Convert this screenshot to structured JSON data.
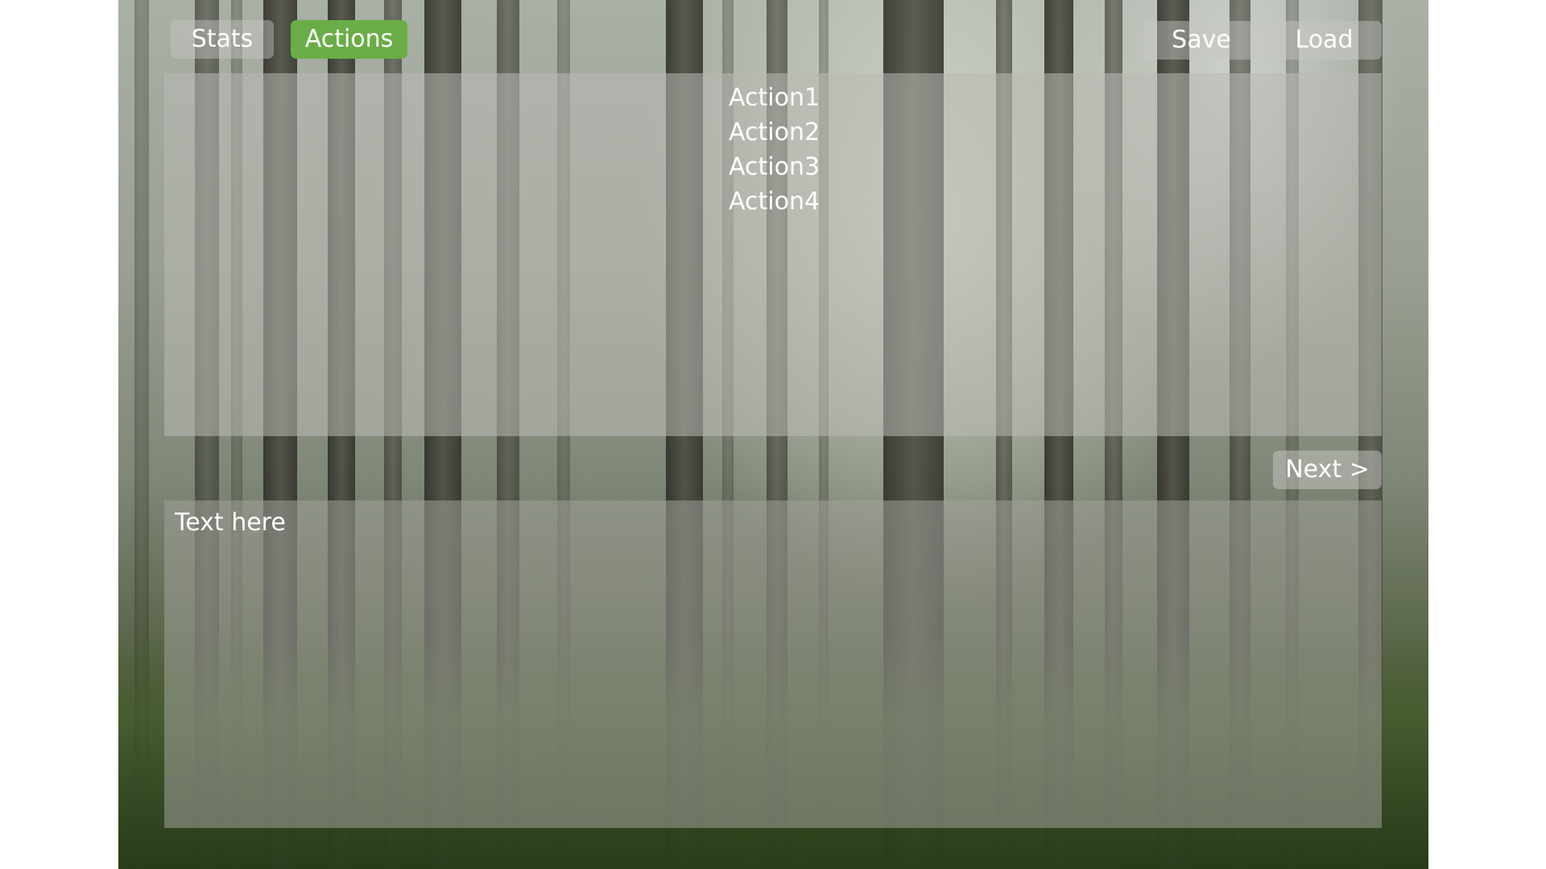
{
  "top_bar": {
    "stats_label": "Stats",
    "actions_label": "Actions",
    "save_label": "Save",
    "load_label": "Load"
  },
  "actions": {
    "items": [
      "Action1",
      "Action2",
      "Action3",
      "Action4"
    ]
  },
  "controls": {
    "next_label": "Next >"
  },
  "text_panel": {
    "content": "Text here"
  },
  "colors": {
    "active_tab": "#6aad46",
    "text": "#ffffff"
  },
  "background": {
    "scene": "misty-forest"
  }
}
